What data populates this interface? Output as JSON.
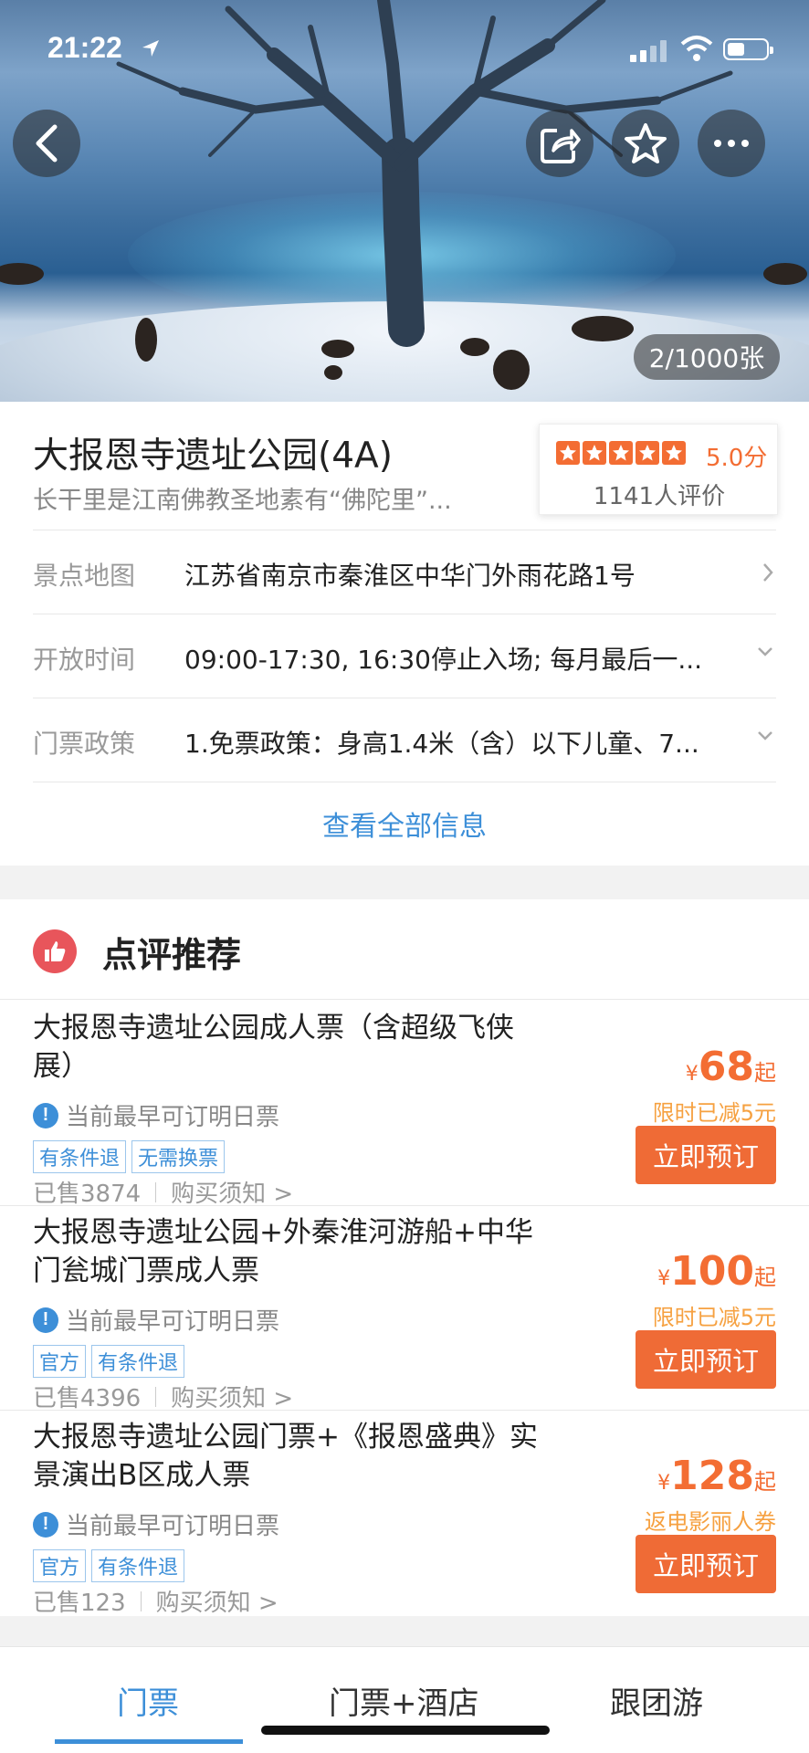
{
  "status_bar": {
    "time": "21:22"
  },
  "hero": {
    "photo_counter": "2/1000张"
  },
  "attraction": {
    "title": "大报恩寺遗址公园(4A)",
    "subtitle": "长干里是江南佛教圣地素有“佛陀里”...",
    "rating_score": "5.0分",
    "rating_count": "1141人评价",
    "rating_stars": 5
  },
  "details": [
    {
      "label": "景点地图",
      "value": "江苏省南京市秦淮区中华门外雨花路1号",
      "icon": "chevron-right-icon"
    },
    {
      "label": "开放时间",
      "value": "09:00-17:30, 16:30停止入场; 每月最后一...",
      "icon": "chevron-down-icon"
    },
    {
      "label": "门票政策",
      "value": "1.免票政策：身高1.4米（含）以下儿童、7...",
      "icon": "chevron-down-icon"
    }
  ],
  "view_all": "查看全部信息",
  "recommend": {
    "title": "点评推荐",
    "items": [
      {
        "name": "大报恩寺遗址公园成人票（含超级飞侠展）",
        "availability": "当前最早可订明日票",
        "tags": [
          "有条件退",
          "无需换票"
        ],
        "sold": "已售3874",
        "notice": "购买须知 >",
        "currency": "¥",
        "price": "68",
        "price_suffix": "起",
        "promo": "限时已减5元",
        "button": "立即预订"
      },
      {
        "name": "大报恩寺遗址公园+外秦淮河游船+中华门瓮城门票成人票",
        "availability": "当前最早可订明日票",
        "tags": [
          "官方",
          "有条件退"
        ],
        "sold": "已售4396",
        "notice": "购买须知 >",
        "currency": "¥",
        "price": "100",
        "price_suffix": "起",
        "promo": "限时已减5元",
        "button": "立即预订"
      },
      {
        "name": "大报恩寺遗址公园门票+《报恩盛典》实景演出B区成人票",
        "availability": "当前最早可订明日票",
        "tags": [
          "官方",
          "有条件退"
        ],
        "sold": "已售123",
        "notice": "购买须知 >",
        "currency": "¥",
        "price": "128",
        "price_suffix": "起",
        "promo": "返电影丽人券",
        "button": "立即预订"
      }
    ]
  },
  "tabs": [
    {
      "label": "门票",
      "active": true
    },
    {
      "label": "门票+酒店",
      "active": false
    },
    {
      "label": "跟团游",
      "active": false
    }
  ],
  "colors": {
    "accent": "#3d8fd8",
    "orange": "#ef6b36",
    "promo": "#f6a141"
  }
}
